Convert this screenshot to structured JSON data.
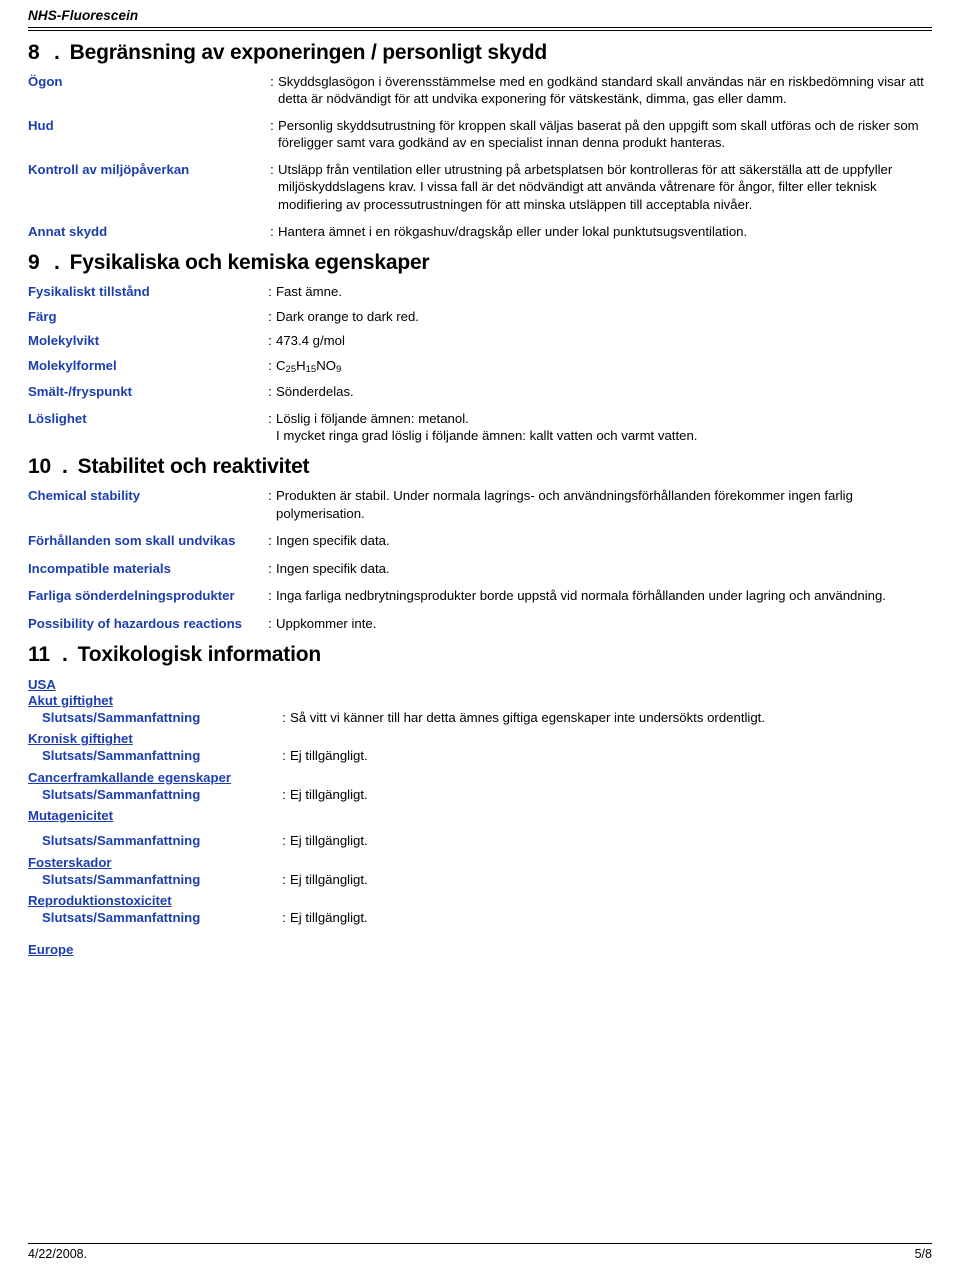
{
  "document": {
    "header_title": "NHS-Fluorescein",
    "footer_date": "4/22/2008.",
    "footer_page": "5/8"
  },
  "section8": {
    "number": "8",
    "dot": ".",
    "title": "Begränsning av exponeringen / personligt skydd",
    "rows": [
      {
        "label": "Ögon",
        "colon": ":",
        "value": "Skyddsglasögon i överensstämmelse med en godkänd standard skall användas när en riskbedömning visar att detta är nödvändigt för att undvika exponering för vätskestänk, dimma, gas eller damm."
      },
      {
        "label": "Hud",
        "colon": ":",
        "value": "Personlig skyddsutrustning för kroppen skall väljas baserat på den uppgift som skall utföras och de risker som föreligger samt vara godkänd av en specialist innan denna produkt hanteras."
      },
      {
        "label": "Kontroll av miljöpåverkan",
        "colon": ":",
        "value": "Utsläpp från ventilation eller utrustning på arbetsplatsen bör kontrolleras för att säkerställa att de uppfyller miljöskyddslagens krav.  I vissa fall är det nödvändigt att använda våtrenare för ångor, filter eller teknisk modifiering av processutrustningen för att minska utsläppen till acceptabla nivåer."
      },
      {
        "label": "Annat skydd",
        "colon": ":",
        "value": "Hantera ämnet i en rökgashuv/dragskåp eller under lokal punktutsugsventilation."
      }
    ]
  },
  "section9": {
    "number": "9",
    "dot": ".",
    "title": "Fysikaliska och kemiska egenskaper",
    "rows": [
      {
        "label": "Fysikaliskt tillstånd",
        "colon": ":",
        "value": "Fast ämne."
      },
      {
        "label": "Färg",
        "colon": ":",
        "value": "Dark orange to dark red."
      },
      {
        "label": "Molekylvikt",
        "colon": ":",
        "value": "473.4 g/mol"
      },
      {
        "label": "Molekylformel",
        "colon": ":",
        "value": "C25H15NO9",
        "formula": true
      },
      {
        "label": "Smält-/fryspunkt",
        "colon": ":",
        "value": "Sönderdelas."
      },
      {
        "label": "Löslighet",
        "colon": ":",
        "value": "Löslig i följande ämnen: metanol.\nI mycket ringa grad löslig i följande ämnen: kallt vatten och varmt vatten."
      }
    ],
    "formula_parts": {
      "c": "C",
      "c_sub": "25",
      "h": "H",
      "h_sub": "15",
      "n": "N",
      "o": "O",
      "o_sub": "9"
    }
  },
  "section10": {
    "number": "10",
    "dot": ".",
    "title": "Stabilitet och reaktivitet",
    "rows": [
      {
        "label": "Chemical stability",
        "colon": ":",
        "value": "Produkten är stabil.  Under normala lagrings- och användningsförhållanden förekommer ingen farlig polymerisation."
      },
      {
        "label": "Förhållanden som skall undvikas",
        "colon": ":",
        "value": "Ingen specifik data."
      },
      {
        "label": "Incompatible materials",
        "colon": ":",
        "value": "Ingen specifik data."
      },
      {
        "label": "Farliga sönderdelningsprodukter",
        "colon": ":",
        "value": "Inga farliga nedbrytningsprodukter borde uppstå vid normala förhållanden under lagring och användning."
      },
      {
        "label": "Possibility of hazardous reactions",
        "colon": ":",
        "value": "Uppkommer inte."
      }
    ]
  },
  "section11": {
    "number": "11",
    "dot": ".",
    "title": "Toxikologisk information",
    "region_usa": "USA",
    "region_europe": "Europe",
    "groups": [
      {
        "heading": "Akut giftighet",
        "label": "Slutsats/Sammanfattning",
        "colon": ":",
        "value": "Så vitt vi känner till har detta ämnes giftiga egenskaper inte undersökts ordentligt."
      },
      {
        "heading": "Kronisk giftighet",
        "label": "Slutsats/Sammanfattning",
        "colon": ":",
        "value": "Ej tillgängligt."
      },
      {
        "heading": "Cancerframkallande egenskaper",
        "label": "Slutsats/Sammanfattning",
        "colon": ":",
        "value": "Ej tillgängligt."
      },
      {
        "heading": "Mutagenicitet",
        "label": "Slutsats/Sammanfattning",
        "colon": ":",
        "value": "Ej tillgängligt."
      },
      {
        "heading": "Fosterskador",
        "label": "Slutsats/Sammanfattning",
        "colon": ":",
        "value": "Ej tillgängligt."
      },
      {
        "heading": "Reproduktionstoxicitet",
        "label": "Slutsats/Sammanfattning",
        "colon": ":",
        "value": "Ej tillgängligt."
      }
    ]
  }
}
